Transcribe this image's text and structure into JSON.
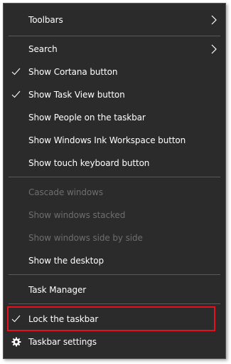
{
  "colors": {
    "menu_bg": "#2b2b2b",
    "text": "#ffffff",
    "disabled_text": "#6e6e6e",
    "separator": "#5a5a5a",
    "highlight_border": "#e8101c"
  },
  "menu": {
    "toolbars": {
      "label": "Toolbars",
      "icon": "chevron-right-icon"
    },
    "search": {
      "label": "Search",
      "icon": "chevron-right-icon"
    },
    "show_cortana": {
      "label": "Show Cortana button",
      "checked": true
    },
    "show_task_view": {
      "label": "Show Task View button",
      "checked": true
    },
    "show_people": {
      "label": "Show People on the taskbar",
      "checked": false
    },
    "show_ink_workspace": {
      "label": "Show Windows Ink Workspace button",
      "checked": false
    },
    "show_touch_keyboard": {
      "label": "Show touch keyboard button",
      "checked": false
    },
    "cascade_windows": {
      "label": "Cascade windows",
      "enabled": false
    },
    "show_stacked": {
      "label": "Show windows stacked",
      "enabled": false
    },
    "show_side_by_side": {
      "label": "Show windows side by side",
      "enabled": false
    },
    "show_desktop": {
      "label": "Show the desktop"
    },
    "task_manager": {
      "label": "Task Manager"
    },
    "lock_taskbar": {
      "label": "Lock the taskbar",
      "checked": true,
      "highlighted": true
    },
    "taskbar_settings": {
      "label": "Taskbar settings",
      "icon": "gear-icon"
    }
  }
}
